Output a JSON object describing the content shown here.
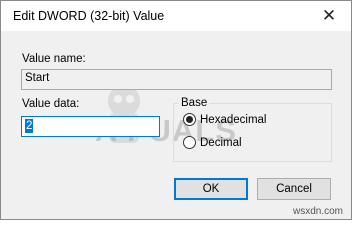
{
  "window": {
    "title": "Edit DWORD (32-bit) Value",
    "close_glyph": "✕"
  },
  "value_name": {
    "label": "Value name:",
    "value": "Start"
  },
  "value_data": {
    "label": "Value data:",
    "value": "2"
  },
  "base": {
    "label": "Base",
    "options": [
      {
        "label": "Hexadecimal",
        "checked": true
      },
      {
        "label": "Decimal",
        "checked": false
      }
    ]
  },
  "buttons": {
    "ok": "OK",
    "cancel": "Cancel"
  },
  "watermark": {
    "text": "A  PUALS",
    "site": "wsxdn.com"
  },
  "colors": {
    "accent": "#0078d7",
    "body_bg": "#f0f0f0"
  }
}
